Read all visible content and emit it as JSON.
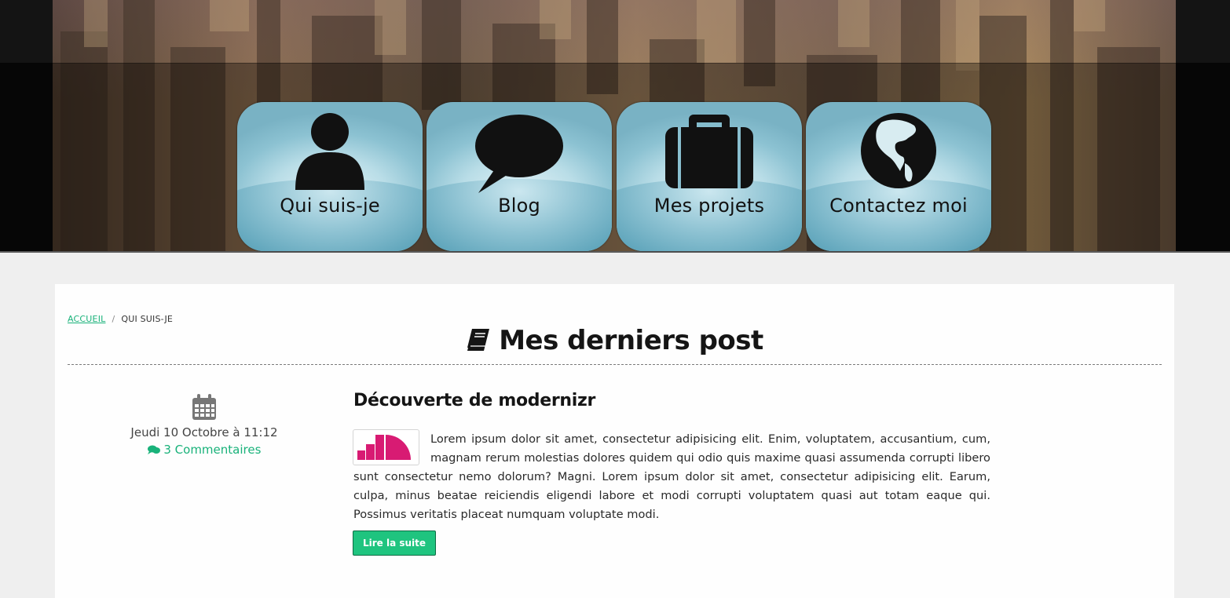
{
  "nav": {
    "items": [
      {
        "label": "Qui suis-je",
        "icon": "user-icon"
      },
      {
        "label": "Blog",
        "icon": "speech-bubble-icon"
      },
      {
        "label": "Mes projets",
        "icon": "briefcase-icon"
      },
      {
        "label": "Contactez moi",
        "icon": "globe-icon"
      }
    ]
  },
  "breadcrumb": {
    "home": "ACCUEIL",
    "separator": "/",
    "current": "QUI SUIS-JE"
  },
  "page": {
    "title": "Mes derniers post"
  },
  "post": {
    "date": "Jeudi 10 Octobre à 11:12",
    "comments": "3 Commentaires",
    "title": "Découverte de modernizr",
    "excerpt": "Lorem ipsum dolor sit amet, consectetur adipisicing elit. Enim, voluptatem, accusantium, cum, magnam rerum molestias dolores quidem qui odio quis maxime quasi assumenda corrupti libero sunt consectetur nemo dolorum? Magni. Lorem ipsum dolor sit amet, consectetur adipisicing elit. Earum, culpa, minus beatae reiciendis eligendi labore et modi corrupti voluptatem quasi aut totam eaque qui. Possimus veritatis placeat numquam voluptate modi.",
    "read_more": "Lire la suite"
  },
  "colors": {
    "accent": "#1fc47f",
    "link": "#19b27a",
    "thumb": "#d81b73"
  }
}
